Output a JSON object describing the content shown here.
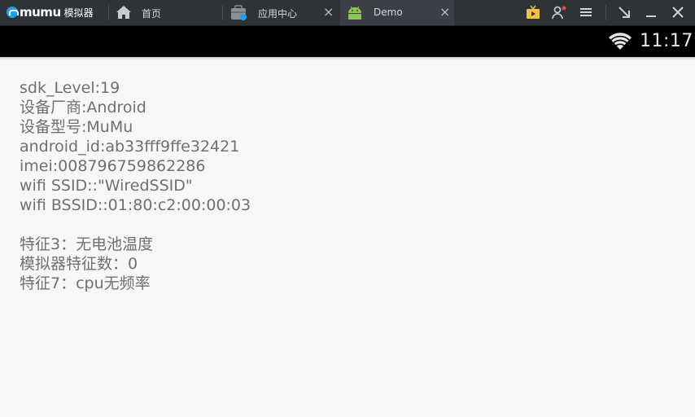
{
  "titlebar": {
    "logo_text": "mumu",
    "logo_sub": "模拟器",
    "tabs": [
      {
        "label": "首页",
        "icon": "home-icon"
      },
      {
        "label": "应用中心",
        "icon": "app-center-icon",
        "close": "×"
      },
      {
        "label": "Demo",
        "icon": "android-icon",
        "close": "×"
      }
    ],
    "controls": [
      "tv-icon",
      "user-settings-icon",
      "menu-icon",
      "shrink-icon",
      "minimize-icon",
      "close-icon"
    ],
    "accent": "#1ea0e8"
  },
  "statusbar": {
    "time": "11:17",
    "wifi": "wifi-icon"
  },
  "device_info": [
    "sdk_Level:19",
    "设备厂商:Android",
    "设备型号:MuMu",
    "android_id:ab33fff9ffe32421",
    "imei:008796759862286",
    "wifi SSID::\"WiredSSID\"",
    "wifi BSSID::01:80:c2:00:00:03"
  ],
  "features": [
    "特征3：无电池温度",
    "模拟器特征数：0",
    "特征7：cpu无频率"
  ]
}
